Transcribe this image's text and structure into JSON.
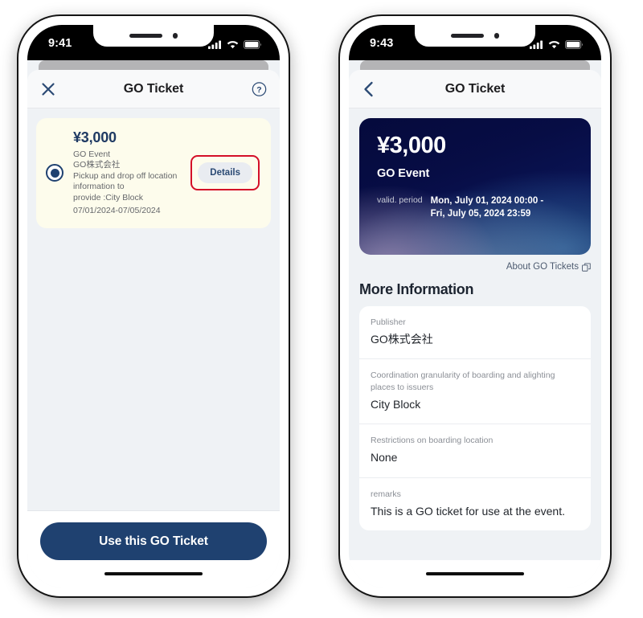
{
  "phone_left": {
    "status": {
      "time": "9:41",
      "signal_icon": "cellular-signal-icon",
      "wifi_icon": "wifi-icon",
      "battery_icon": "battery-icon"
    },
    "nav": {
      "close_icon": "close-icon",
      "title": "GO Ticket",
      "help_icon": "help-circle-icon"
    },
    "ticket": {
      "radio_icon": "radio-selected-icon",
      "price": "¥3,000",
      "event": "GO Event",
      "company": "GO株式会社",
      "description_line1": "Pickup and drop off location",
      "description_line2": "information to",
      "description_line3": "provide :City Block",
      "dates": "07/01/2024-07/05/2024",
      "details_label": "Details",
      "highlight_color": "#d40f28"
    },
    "cta_label": "Use this GO Ticket",
    "cta_color": "#1f4170"
  },
  "phone_right": {
    "status": {
      "time": "9:43",
      "signal_icon": "cellular-signal-icon",
      "wifi_icon": "wifi-icon",
      "battery_icon": "battery-icon"
    },
    "nav": {
      "back_icon": "chevron-left-icon",
      "title": "GO Ticket"
    },
    "gradient_card": {
      "price": "¥3,000",
      "event": "GO Event",
      "valid_label": "valid. period",
      "valid_line1": "Mon, July 01, 2024 00:00 -",
      "valid_line2": "Fri, July 05, 2024 23:59"
    },
    "about_link": {
      "label": "About GO Tickets",
      "icon": "external-link-icon"
    },
    "more_info_title": "More Information",
    "info_rows": [
      {
        "label": "Publisher",
        "value": "GO株式会社"
      },
      {
        "label": "Coordination granularity of boarding and alighting places to issuers",
        "value": "City Block"
      },
      {
        "label": "Restrictions on boarding location",
        "value": "None"
      },
      {
        "label": "remarks",
        "value": "This is a GO ticket for use at the event."
      }
    ]
  }
}
